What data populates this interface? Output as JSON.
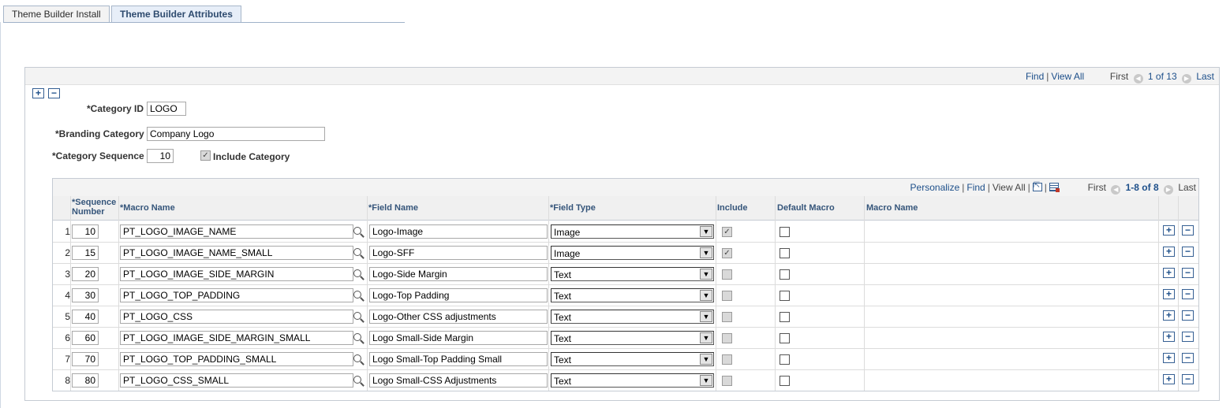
{
  "tabs": [
    {
      "label": "Theme Builder Install",
      "active": false
    },
    {
      "label": "Theme Builder Attributes",
      "active": true
    }
  ],
  "outer_nav": {
    "find": "Find",
    "view_all": "View All",
    "first": "First",
    "count": "1 of 13",
    "last": "Last"
  },
  "form": {
    "category_id_label": "*Category ID",
    "category_id_value": "LOGO",
    "branding_category_label": "*Branding Category",
    "branding_category_value": "Company Logo",
    "category_sequence_label": "*Category Sequence",
    "category_sequence_value": "10",
    "include_category_label": "Include Category",
    "include_category_checked": true
  },
  "grid": {
    "nav": {
      "personalize": "Personalize",
      "find": "Find",
      "view_all": "View All",
      "first": "First",
      "count": "1-8 of 8",
      "last": "Last"
    },
    "headers": {
      "sequence_star": "*",
      "sequence_line1": "Sequence",
      "sequence_line2": "Number",
      "macro_name": "*Macro Name",
      "field_name": "*Field Name",
      "field_type": "*Field Type",
      "include": "Include",
      "default_macro": "Default Macro",
      "macro_name_2": "Macro Name"
    },
    "rows": [
      {
        "num": "1",
        "seq": "10",
        "macro": "PT_LOGO_IMAGE_NAME",
        "field": "Logo-Image",
        "type": "Image",
        "include": true,
        "default_macro": false
      },
      {
        "num": "2",
        "seq": "15",
        "macro": "PT_LOGO_IMAGE_NAME_SMALL",
        "field": "Logo-SFF",
        "type": "Image",
        "include": true,
        "default_macro": false
      },
      {
        "num": "3",
        "seq": "20",
        "macro": "PT_LOGO_IMAGE_SIDE_MARGIN",
        "field": "Logo-Side Margin",
        "type": "Text",
        "include": false,
        "default_macro": false
      },
      {
        "num": "4",
        "seq": "30",
        "macro": "PT_LOGO_TOP_PADDING",
        "field": "Logo-Top Padding",
        "type": "Text",
        "include": false,
        "default_macro": false
      },
      {
        "num": "5",
        "seq": "40",
        "macro": "PT_LOGO_CSS",
        "field": "Logo-Other CSS adjustments",
        "type": "Text",
        "include": false,
        "default_macro": false
      },
      {
        "num": "6",
        "seq": "60",
        "macro": "PT_LOGO_IMAGE_SIDE_MARGIN_SMALL",
        "field": "Logo Small-Side Margin",
        "type": "Text",
        "include": false,
        "default_macro": false
      },
      {
        "num": "7",
        "seq": "70",
        "macro": "PT_LOGO_TOP_PADDING_SMALL",
        "field": "Logo Small-Top Padding Small",
        "type": "Text",
        "include": false,
        "default_macro": false
      },
      {
        "num": "8",
        "seq": "80",
        "macro": "PT_LOGO_CSS_SMALL",
        "field": "Logo Small-CSS Adjustments",
        "type": "Text",
        "include": false,
        "default_macro": false
      }
    ]
  },
  "icons": {
    "add": "plus-icon",
    "delete": "minus-icon",
    "lookup": "magnifier-icon",
    "prev": "arrow-left-icon",
    "next": "arrow-right-icon",
    "zoom": "zoom-grid-icon",
    "download": "spreadsheet-download-icon"
  },
  "colors": {
    "link": "#1d4f8a",
    "header_bg": "#f3f3f3",
    "border": "#c5cbd3"
  }
}
